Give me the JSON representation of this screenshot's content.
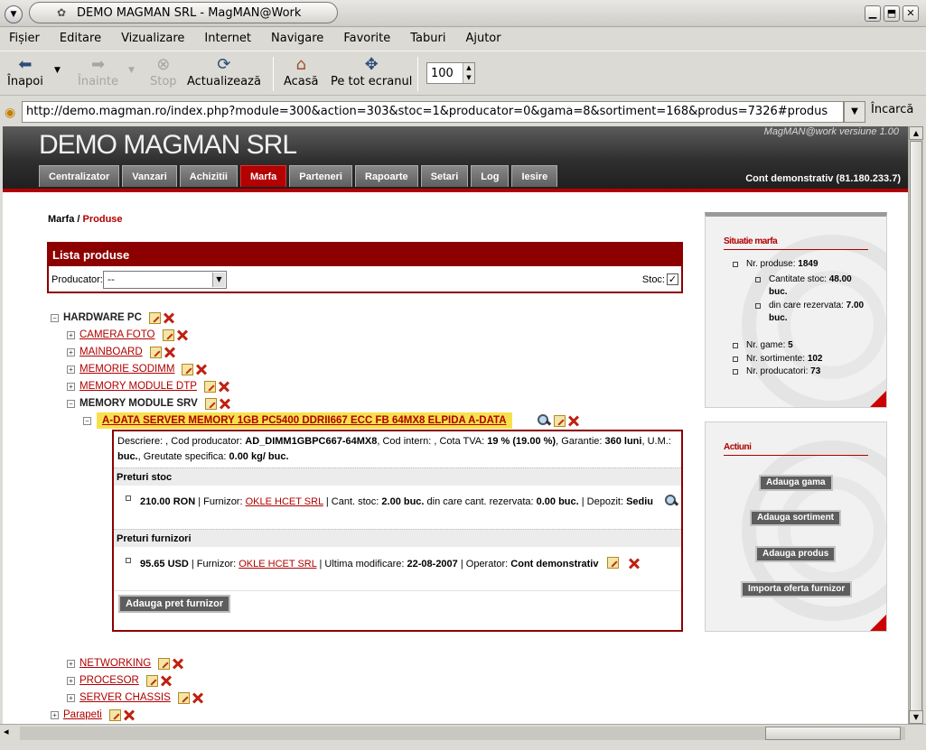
{
  "window": {
    "title": "DEMO MAGMAN SRL - MagMAN@Work"
  },
  "menubar": [
    "Fișier",
    "Editare",
    "Vizualizare",
    "Internet",
    "Navigare",
    "Favorite",
    "Taburi",
    "Ajutor"
  ],
  "toolbar": {
    "back": "Înapoi",
    "forward": "Înainte",
    "stop": "Stop",
    "reload": "Actualizează",
    "home": "Acasă",
    "fullscreen": "Pe tot ecranul",
    "zoom": "100"
  },
  "location": {
    "url": "http://demo.magman.ro/index.php?module=300&action=303&stoc=1&producator=0&gama=8&sortiment=168&produs=7326#produs",
    "load": "Încarcă"
  },
  "site": {
    "title": "DEMO MAGMAN SRL",
    "version": "MagMAN@work versiune 1.00",
    "account": "Cont demonstrativ (81.180.233.7)",
    "tabs": [
      "Centralizator",
      "Vanzari",
      "Achizitii",
      "Marfa",
      "Parteneri",
      "Rapoarte",
      "Setari",
      "Log",
      "Iesire"
    ],
    "active_tab": "Marfa"
  },
  "breadcrumb": {
    "root": "Marfa",
    "sep": " / ",
    "current": "Produse"
  },
  "list": {
    "title": "Lista produse",
    "producator_label": "Producator:",
    "producator_value": "--",
    "stoc_label": "Stoc:",
    "stoc_checked": "✓"
  },
  "tree": {
    "root": "HARDWARE PC",
    "children": [
      "CAMERA FOTO",
      "MAINBOARD",
      "MEMORIE SODIMM",
      "MEMORY MODULE DTP"
    ],
    "open": "MEMORY MODULE SRV",
    "product": "A-DATA SERVER MEMORY 1GB PC5400 DDRII667 ECC FB 64MX8 ELPIDA A-DATA",
    "after": [
      "NETWORKING",
      "PROCESOR",
      "SERVER CHASSIS"
    ],
    "sibling_root": "Parapeti"
  },
  "detail": {
    "desc_l": "Descriere:",
    "desc_v": " , ",
    "cod_prod_l": "Cod producator:",
    "cod_prod_v": "AD_DIMM1GBPC667-64MX8",
    "cod_int_l": ", Cod intern:",
    "cota_l": " , Cota TVA:",
    "cota_v": "19 % (19.00 %)",
    "garantie_l": ", Garantie:",
    "garantie_v": "360 luni",
    "um_l": ", U.M.:",
    "um_v": "buc.",
    "greut_l": ", Greutate specifica:",
    "greut_v": "0.00 kg/ buc.",
    "preturi_stoc": "Preturi stoc",
    "stoc_price": "210.00 RON",
    "furnizor_l": " | Furnizor: ",
    "furnizor": "OKLE HCET SRL",
    "cant_l": " | Cant. stoc: ",
    "cant_v": "2.00 buc.",
    "rez_l": " din care cant. rezervata: ",
    "rez_v": "0.00 buc.",
    "depozit_l": " | Depozit: ",
    "depozit_v": "Sediu",
    "preturi_furnizori": "Preturi furnizori",
    "furn_price": "95.65 USD",
    "modif_l": " | Ultima modificare: ",
    "modif_v": "22-08-2007",
    "oper_l": " | Operator: ",
    "oper_v": "Cont demonstrativ",
    "add_btn": "Adauga pret furnizor"
  },
  "situatie": {
    "title": "Situatie marfa",
    "nr_produse_l": "Nr. produse:",
    "nr_produse_v": "1849",
    "cant_stoc_l": "Cantitate stoc:",
    "cant_stoc_v": "48.00 buc.",
    "rez_l": "din care rezervata:",
    "rez_v": "7.00 buc.",
    "nr_game_l": "Nr. game:",
    "nr_game_v": "5",
    "nr_sort_l": "Nr. sortimente:",
    "nr_sort_v": "102",
    "nr_prod_l": "Nr. producatori:",
    "nr_prod_v": "73"
  },
  "actiuni": {
    "title": "Actiuni",
    "buttons": [
      "Adauga gama",
      "Adauga sortiment",
      "Adauga produs",
      "Importa oferta furnizor"
    ]
  }
}
